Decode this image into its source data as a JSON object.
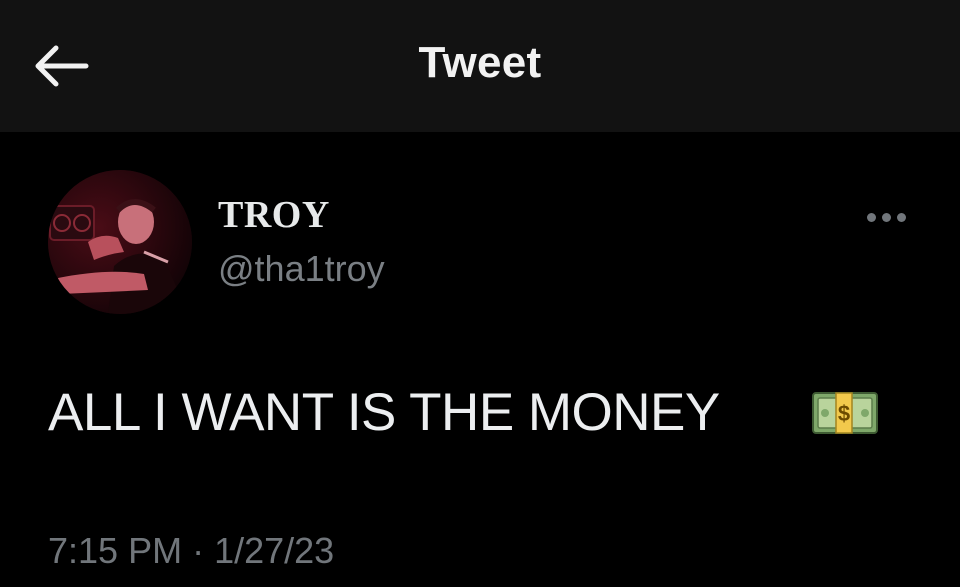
{
  "header": {
    "title": "Tweet",
    "back_icon": "arrow-left-icon"
  },
  "author": {
    "display_name": "TROY",
    "handle": "@tha1troy",
    "avatar_icon": "avatar-photo"
  },
  "tweet": {
    "text": "ALL I WANT IS THE MONEY",
    "emoji_icon": "money-banknote-icon",
    "time": "7:15 PM",
    "separator": " · ",
    "date": "1/27/23"
  },
  "actions": {
    "more_icon": "more-horizontal-icon"
  },
  "colors": {
    "background": "#000000",
    "header_bg": "#121212",
    "primary_text": "#e7e9ea",
    "secondary_text": "#71767b"
  }
}
